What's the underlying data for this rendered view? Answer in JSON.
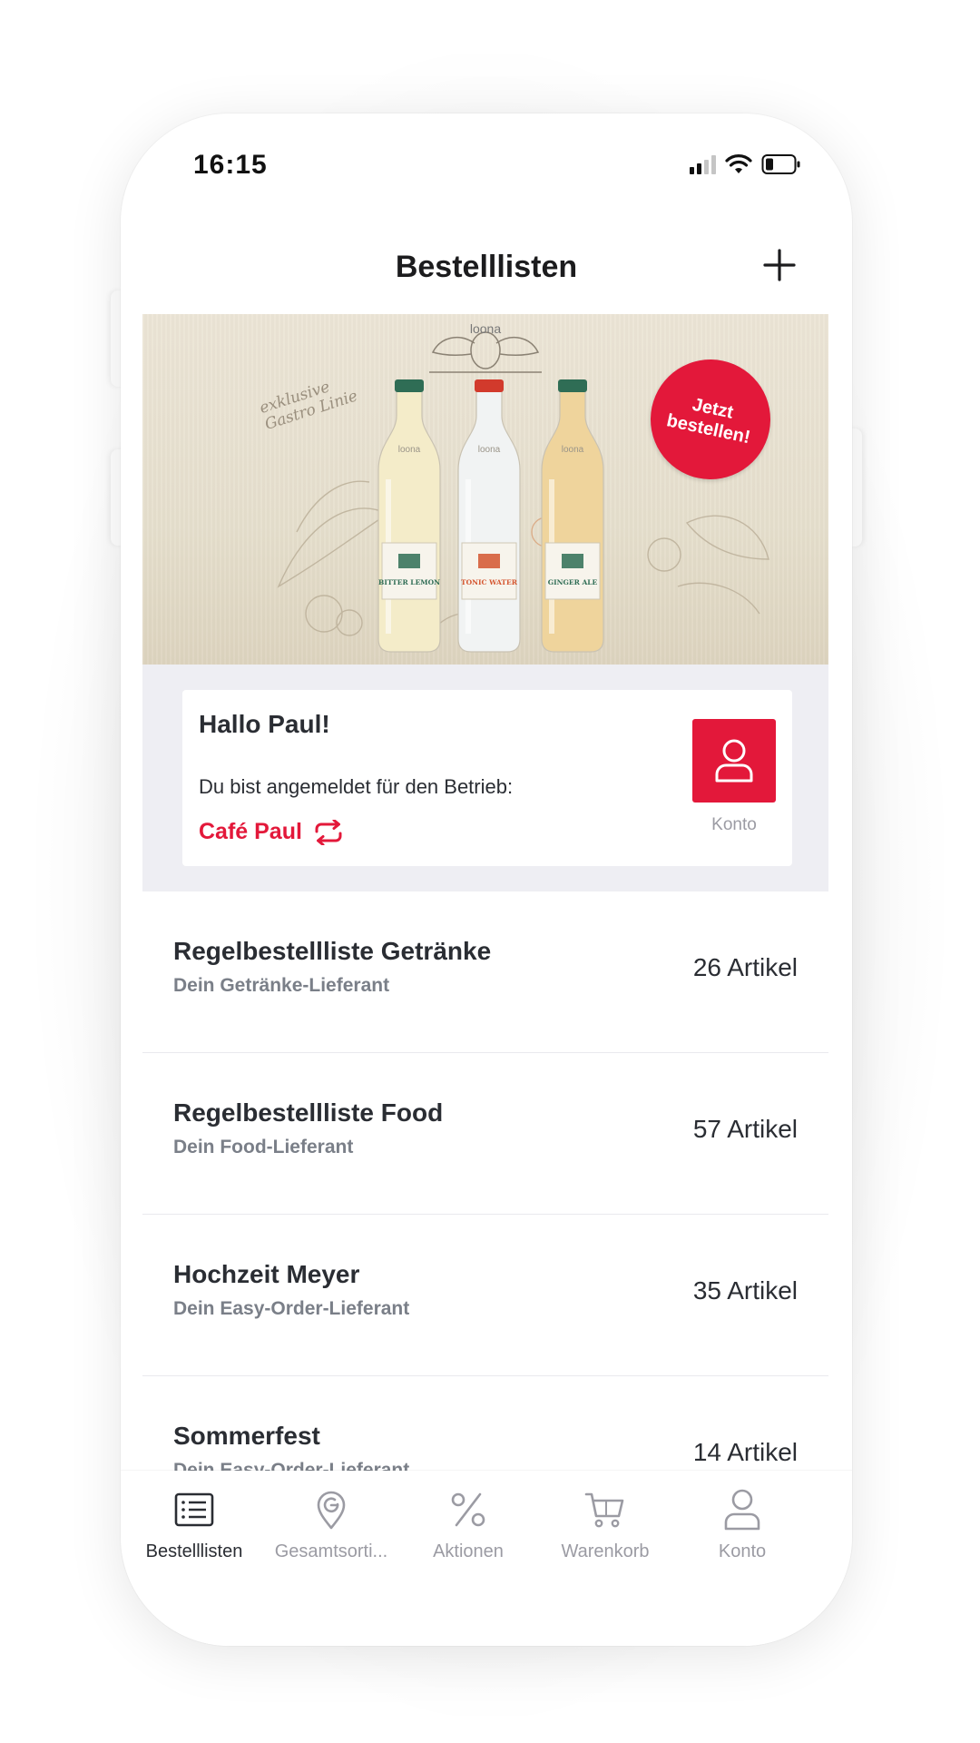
{
  "status_bar": {
    "time": "16:15"
  },
  "header": {
    "title": "Bestelllisten"
  },
  "banner": {
    "brand": "loona",
    "script_text": "exklusive Gastro Linie",
    "bottles": [
      {
        "name": "BITTER LEMON",
        "color": "#f4ecc9",
        "cap": "#2f6d55",
        "label_color": "#2f6d55"
      },
      {
        "name": "TONIC WATER",
        "color": "#f1f3f3",
        "cap": "#d23a2c",
        "label_color": "#d4552f"
      },
      {
        "name": "GINGER ALE",
        "color": "#efd49c",
        "cap": "#2f6d55",
        "label_color": "#2f6d55"
      }
    ],
    "cta_line1": "Jetzt",
    "cta_line2": "bestellen!"
  },
  "greeting": {
    "hello": "Hallo Paul!",
    "subtitle": "Du bist angemeldet für den Betrieb:",
    "company": "Café Paul",
    "account_label": "Konto"
  },
  "order_lists": [
    {
      "title": "Regelbestellliste Getränke",
      "supplier": "Dein Getränke-Lieferant",
      "count": "26 Artikel"
    },
    {
      "title": "Regelbestellliste Food",
      "supplier": "Dein Food-Lieferant",
      "count": "57 Artikel"
    },
    {
      "title": "Hochzeit Meyer",
      "supplier": "Dein Easy-Order-Lieferant",
      "count": "35 Artikel"
    },
    {
      "title": "Sommerfest",
      "supplier": "Dein Easy-Order-Lieferant",
      "count": "14 Artikel"
    }
  ],
  "tabbar": {
    "tabs": [
      {
        "label": "Bestelllisten",
        "icon": "list-icon",
        "active": true
      },
      {
        "label": "Gesamtsorti...",
        "icon": "location-pin-icon",
        "active": false
      },
      {
        "label": "Aktionen",
        "icon": "percent-icon",
        "active": false
      },
      {
        "label": "Warenkorb",
        "icon": "cart-icon",
        "active": false
      },
      {
        "label": "Konto",
        "icon": "user-icon",
        "active": false
      }
    ]
  },
  "colors": {
    "accent": "#e3183a",
    "text_primary": "#2a2d33",
    "text_secondary": "#7a7f88",
    "inactive": "#9b9ba3"
  }
}
